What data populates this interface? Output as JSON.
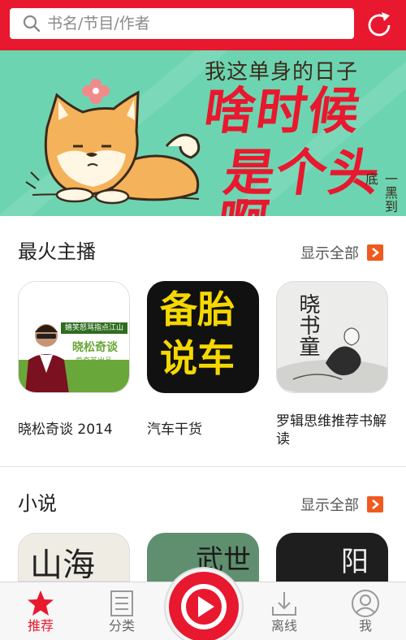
{
  "search": {
    "placeholder": "书名/节目/作者"
  },
  "banner": {
    "top_text": "我这单身的日子",
    "line1": "啥时候",
    "line2": "是个头啊",
    "side_text": "一黑到底"
  },
  "sections": [
    {
      "title": "最火主播",
      "show_all": "显示全部",
      "items": [
        {
          "label": "晓松奇谈 2014",
          "cover_top": "嬉笑怒骂指点江山",
          "cover_brand": "晓松奇谈",
          "cover_sub": "爱奇艺出品"
        },
        {
          "label": "汽车干货",
          "cover_text1": "备胎",
          "cover_text2": "说车"
        },
        {
          "label": "罗辑思维推荐书解读",
          "cover_text1": "晓书童"
        }
      ]
    },
    {
      "title": "小说",
      "show_all": "显示全部",
      "items": [
        {
          "cover_text": "山海"
        },
        {
          "cover_text": "武世九"
        },
        {
          "cover_text": "阳"
        }
      ]
    }
  ],
  "tabs": [
    {
      "label": "推荐",
      "icon": "star-icon",
      "active": true
    },
    {
      "label": "分类",
      "icon": "list-icon",
      "active": false
    },
    {
      "label": "离线",
      "icon": "download-icon",
      "active": false
    },
    {
      "label": "我",
      "icon": "user-icon",
      "active": false
    }
  ],
  "colors": {
    "brand": "#e8182e",
    "accent": "#f05a1e",
    "banner_bg": "#6dd4b1"
  }
}
